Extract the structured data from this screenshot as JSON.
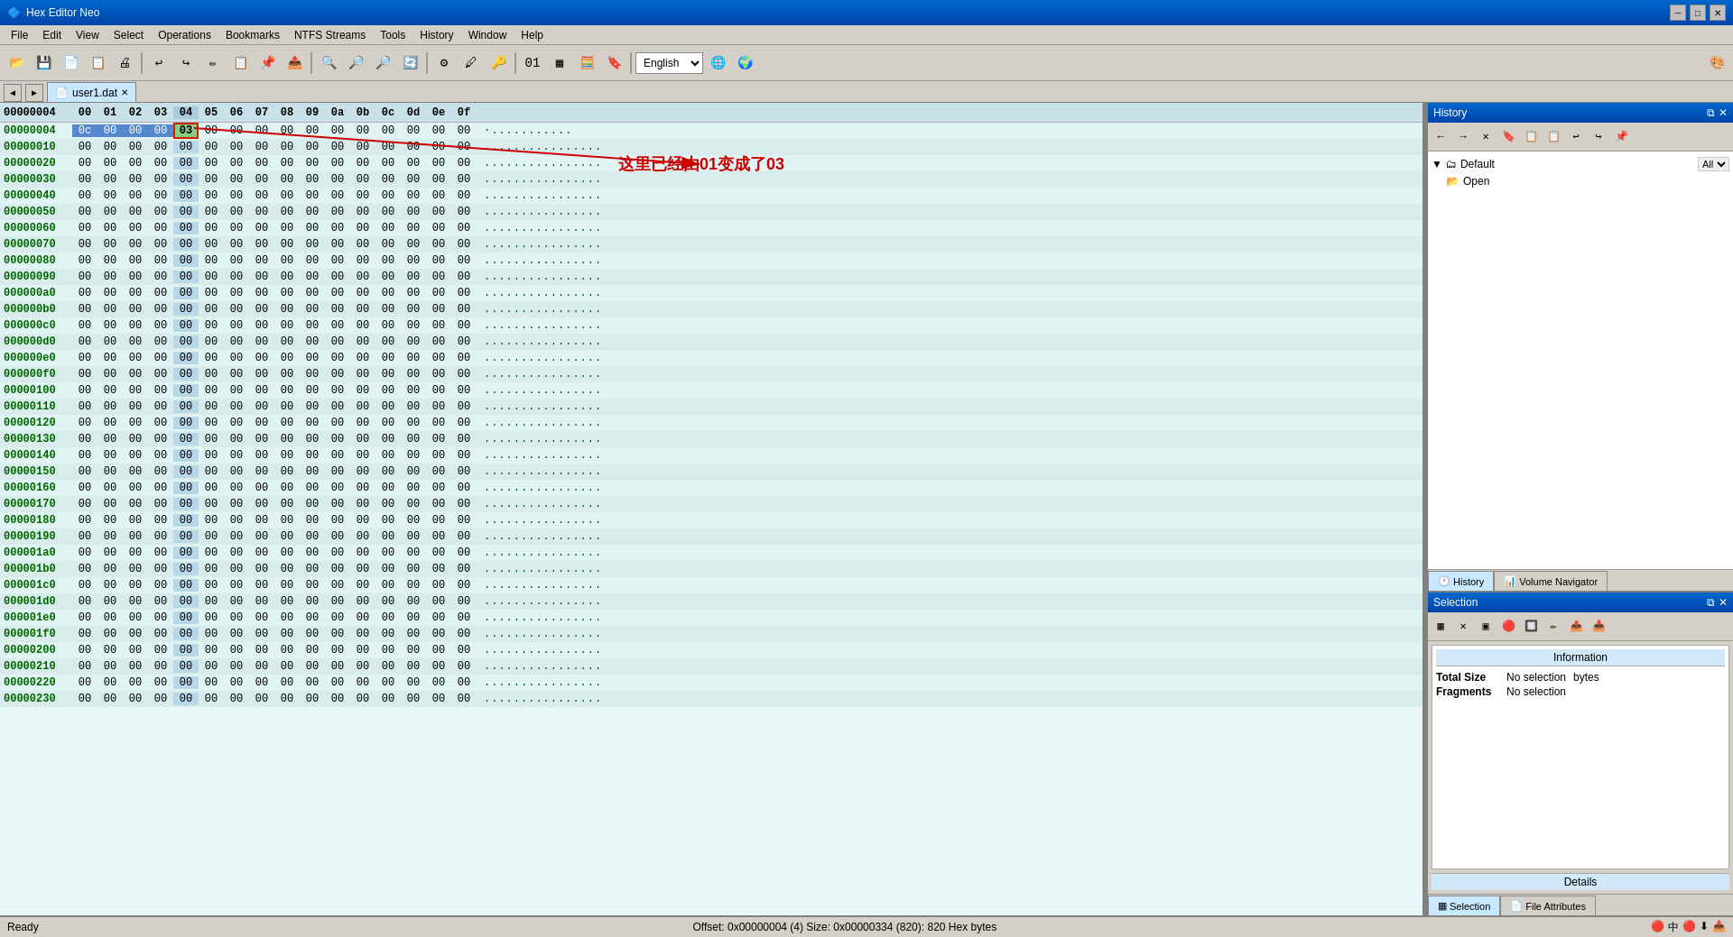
{
  "app": {
    "title": "Hex Editor Neo",
    "icon": "🔷"
  },
  "titlebar": {
    "minimize": "─",
    "maximize": "□",
    "close": "✕"
  },
  "menu": {
    "items": [
      "File",
      "Edit",
      "View",
      "Select",
      "Operations",
      "Bookmarks",
      "NTFS Streams",
      "Tools",
      "History",
      "Window",
      "Help"
    ]
  },
  "toolbar": {
    "lang_value": "English"
  },
  "tabs": [
    {
      "name": "user1.dat",
      "active": true
    }
  ],
  "hex_header": {
    "addr": "00000004",
    "cols": [
      "00",
      "01",
      "02",
      "03",
      "04",
      "05",
      "06",
      "07",
      "08",
      "09",
      "0a",
      "0b",
      "0c",
      "0d",
      "0e",
      "0f"
    ]
  },
  "hex_rows": [
    {
      "addr": "00000004",
      "cells": [
        "0c",
        "00",
        "00",
        "00",
        "03",
        "00",
        "00",
        "00",
        "00",
        "00",
        "00",
        "00",
        "00",
        "00",
        "00",
        "00"
      ],
      "ascii": "................",
      "highlight_col": 4,
      "cursor": 4
    },
    {
      "addr": "00000010",
      "cells": [
        "00",
        "00",
        "00",
        "00",
        "00",
        "00",
        "00",
        "00",
        "00",
        "00",
        "00",
        "00",
        "00",
        "00",
        "00",
        "00"
      ],
      "ascii": "................"
    },
    {
      "addr": "00000020",
      "cells": [
        "00",
        "00",
        "00",
        "00",
        "00",
        "00",
        "00",
        "00",
        "00",
        "00",
        "00",
        "00",
        "00",
        "00",
        "00",
        "00"
      ],
      "ascii": "................"
    },
    {
      "addr": "00000030",
      "cells": [
        "00",
        "00",
        "00",
        "00",
        "00",
        "00",
        "00",
        "00",
        "00",
        "00",
        "00",
        "00",
        "00",
        "00",
        "00",
        "00"
      ],
      "ascii": "................"
    },
    {
      "addr": "00000040",
      "cells": [
        "00",
        "00",
        "00",
        "00",
        "00",
        "00",
        "00",
        "00",
        "00",
        "00",
        "00",
        "00",
        "00",
        "00",
        "00",
        "00"
      ],
      "ascii": "................"
    },
    {
      "addr": "00000050",
      "cells": [
        "00",
        "00",
        "00",
        "00",
        "00",
        "00",
        "00",
        "00",
        "00",
        "00",
        "00",
        "00",
        "00",
        "00",
        "00",
        "00"
      ],
      "ascii": "................"
    },
    {
      "addr": "00000060",
      "cells": [
        "00",
        "00",
        "00",
        "00",
        "00",
        "00",
        "00",
        "00",
        "00",
        "00",
        "00",
        "00",
        "00",
        "00",
        "00",
        "00"
      ],
      "ascii": "................"
    },
    {
      "addr": "00000070",
      "cells": [
        "00",
        "00",
        "00",
        "00",
        "00",
        "00",
        "00",
        "00",
        "00",
        "00",
        "00",
        "00",
        "00",
        "00",
        "00",
        "00"
      ],
      "ascii": "................"
    },
    {
      "addr": "00000080",
      "cells": [
        "00",
        "00",
        "00",
        "00",
        "00",
        "00",
        "00",
        "00",
        "00",
        "00",
        "00",
        "00",
        "00",
        "00",
        "00",
        "00"
      ],
      "ascii": "................"
    },
    {
      "addr": "00000090",
      "cells": [
        "00",
        "00",
        "00",
        "00",
        "00",
        "00",
        "00",
        "00",
        "00",
        "00",
        "00",
        "00",
        "00",
        "00",
        "00",
        "00"
      ],
      "ascii": "................"
    },
    {
      "addr": "000000a0",
      "cells": [
        "00",
        "00",
        "00",
        "00",
        "00",
        "00",
        "00",
        "00",
        "00",
        "00",
        "00",
        "00",
        "00",
        "00",
        "00",
        "00"
      ],
      "ascii": "................"
    },
    {
      "addr": "000000b0",
      "cells": [
        "00",
        "00",
        "00",
        "00",
        "00",
        "00",
        "00",
        "00",
        "00",
        "00",
        "00",
        "00",
        "00",
        "00",
        "00",
        "00"
      ],
      "ascii": "................"
    },
    {
      "addr": "000000c0",
      "cells": [
        "00",
        "00",
        "00",
        "00",
        "00",
        "00",
        "00",
        "00",
        "00",
        "00",
        "00",
        "00",
        "00",
        "00",
        "00",
        "00"
      ],
      "ascii": "................"
    },
    {
      "addr": "000000d0",
      "cells": [
        "00",
        "00",
        "00",
        "00",
        "00",
        "00",
        "00",
        "00",
        "00",
        "00",
        "00",
        "00",
        "00",
        "00",
        "00",
        "00"
      ],
      "ascii": "................"
    },
    {
      "addr": "000000e0",
      "cells": [
        "00",
        "00",
        "00",
        "00",
        "00",
        "00",
        "00",
        "00",
        "00",
        "00",
        "00",
        "00",
        "00",
        "00",
        "00",
        "00"
      ],
      "ascii": "................"
    },
    {
      "addr": "000000f0",
      "cells": [
        "00",
        "00",
        "00",
        "00",
        "00",
        "00",
        "00",
        "00",
        "00",
        "00",
        "00",
        "00",
        "00",
        "00",
        "00",
        "00"
      ],
      "ascii": "................"
    },
    {
      "addr": "00000100",
      "cells": [
        "00",
        "00",
        "00",
        "00",
        "00",
        "00",
        "00",
        "00",
        "00",
        "00",
        "00",
        "00",
        "00",
        "00",
        "00",
        "00"
      ],
      "ascii": "................"
    },
    {
      "addr": "00000110",
      "cells": [
        "00",
        "00",
        "00",
        "00",
        "00",
        "00",
        "00",
        "00",
        "00",
        "00",
        "00",
        "00",
        "00",
        "00",
        "00",
        "00"
      ],
      "ascii": "................"
    },
    {
      "addr": "00000120",
      "cells": [
        "00",
        "00",
        "00",
        "00",
        "00",
        "00",
        "00",
        "00",
        "00",
        "00",
        "00",
        "00",
        "00",
        "00",
        "00",
        "00"
      ],
      "ascii": "................"
    },
    {
      "addr": "00000130",
      "cells": [
        "00",
        "00",
        "00",
        "00",
        "00",
        "00",
        "00",
        "00",
        "00",
        "00",
        "00",
        "00",
        "00",
        "00",
        "00",
        "00"
      ],
      "ascii": "................"
    },
    {
      "addr": "00000140",
      "cells": [
        "00",
        "00",
        "00",
        "00",
        "00",
        "00",
        "00",
        "00",
        "00",
        "00",
        "00",
        "00",
        "00",
        "00",
        "00",
        "00"
      ],
      "ascii": "................"
    },
    {
      "addr": "00000150",
      "cells": [
        "00",
        "00",
        "00",
        "00",
        "00",
        "00",
        "00",
        "00",
        "00",
        "00",
        "00",
        "00",
        "00",
        "00",
        "00",
        "00"
      ],
      "ascii": "................"
    },
    {
      "addr": "00000160",
      "cells": [
        "00",
        "00",
        "00",
        "00",
        "00",
        "00",
        "00",
        "00",
        "00",
        "00",
        "00",
        "00",
        "00",
        "00",
        "00",
        "00"
      ],
      "ascii": "................"
    },
    {
      "addr": "00000170",
      "cells": [
        "00",
        "00",
        "00",
        "00",
        "00",
        "00",
        "00",
        "00",
        "00",
        "00",
        "00",
        "00",
        "00",
        "00",
        "00",
        "00"
      ],
      "ascii": "................"
    },
    {
      "addr": "00000180",
      "cells": [
        "00",
        "00",
        "00",
        "00",
        "00",
        "00",
        "00",
        "00",
        "00",
        "00",
        "00",
        "00",
        "00",
        "00",
        "00",
        "00"
      ],
      "ascii": "................"
    },
    {
      "addr": "00000190",
      "cells": [
        "00",
        "00",
        "00",
        "00",
        "00",
        "00",
        "00",
        "00",
        "00",
        "00",
        "00",
        "00",
        "00",
        "00",
        "00",
        "00"
      ],
      "ascii": "................"
    },
    {
      "addr": "000001a0",
      "cells": [
        "00",
        "00",
        "00",
        "00",
        "00",
        "00",
        "00",
        "00",
        "00",
        "00",
        "00",
        "00",
        "00",
        "00",
        "00",
        "00"
      ],
      "ascii": "................"
    },
    {
      "addr": "000001b0",
      "cells": [
        "00",
        "00",
        "00",
        "00",
        "00",
        "00",
        "00",
        "00",
        "00",
        "00",
        "00",
        "00",
        "00",
        "00",
        "00",
        "00"
      ],
      "ascii": "................"
    },
    {
      "addr": "000001c0",
      "cells": [
        "00",
        "00",
        "00",
        "00",
        "00",
        "00",
        "00",
        "00",
        "00",
        "00",
        "00",
        "00",
        "00",
        "00",
        "00",
        "00"
      ],
      "ascii": "................"
    },
    {
      "addr": "000001d0",
      "cells": [
        "00",
        "00",
        "00",
        "00",
        "00",
        "00",
        "00",
        "00",
        "00",
        "00",
        "00",
        "00",
        "00",
        "00",
        "00",
        "00"
      ],
      "ascii": "................"
    },
    {
      "addr": "000001e0",
      "cells": [
        "00",
        "00",
        "00",
        "00",
        "00",
        "00",
        "00",
        "00",
        "00",
        "00",
        "00",
        "00",
        "00",
        "00",
        "00",
        "00"
      ],
      "ascii": "................"
    },
    {
      "addr": "000001f0",
      "cells": [
        "00",
        "00",
        "00",
        "00",
        "00",
        "00",
        "00",
        "00",
        "00",
        "00",
        "00",
        "00",
        "00",
        "00",
        "00",
        "00"
      ],
      "ascii": "................"
    },
    {
      "addr": "00000200",
      "cells": [
        "00",
        "00",
        "00",
        "00",
        "00",
        "00",
        "00",
        "00",
        "00",
        "00",
        "00",
        "00",
        "00",
        "00",
        "00",
        "00"
      ],
      "ascii": "................"
    },
    {
      "addr": "00000210",
      "cells": [
        "00",
        "00",
        "00",
        "00",
        "00",
        "00",
        "00",
        "00",
        "00",
        "00",
        "00",
        "00",
        "00",
        "00",
        "00",
        "00"
      ],
      "ascii": "................"
    },
    {
      "addr": "00000220",
      "cells": [
        "00",
        "00",
        "00",
        "00",
        "00",
        "00",
        "00",
        "00",
        "00",
        "00",
        "00",
        "00",
        "00",
        "00",
        "00",
        "00"
      ],
      "ascii": "................"
    },
    {
      "addr": "00000230",
      "cells": [
        "00",
        "00",
        "00",
        "00",
        "00",
        "00",
        "00",
        "00",
        "00",
        "00",
        "00",
        "00",
        "00",
        "00",
        "00",
        "00"
      ],
      "ascii": "................"
    }
  ],
  "history_panel": {
    "title": "History",
    "toolbar_buttons": [
      "←",
      "→",
      "✕",
      "🔖",
      "📋",
      "📋",
      "↩",
      "↪",
      "📌"
    ],
    "tree": {
      "default_label": "Default",
      "open_label": "Open"
    },
    "bottom_tabs": [
      "History",
      "Volume Navigator"
    ]
  },
  "selection_panel": {
    "title": "Selection",
    "info_header": "Information",
    "total_size_label": "Total Size",
    "total_size_value": "No selection",
    "total_size_unit": "bytes",
    "fragments_label": "Fragments",
    "fragments_value": "No selection",
    "details_label": "Details",
    "bottom_tabs": [
      "Selection",
      "File Attributes"
    ]
  },
  "status_bar": {
    "ready": "Ready",
    "offset": "Offset: 0x00000004 (4)  Size: 0x00000334 (820): 820  Hex bytes"
  },
  "annotation": {
    "text": "这里已经由01变成了03"
  }
}
